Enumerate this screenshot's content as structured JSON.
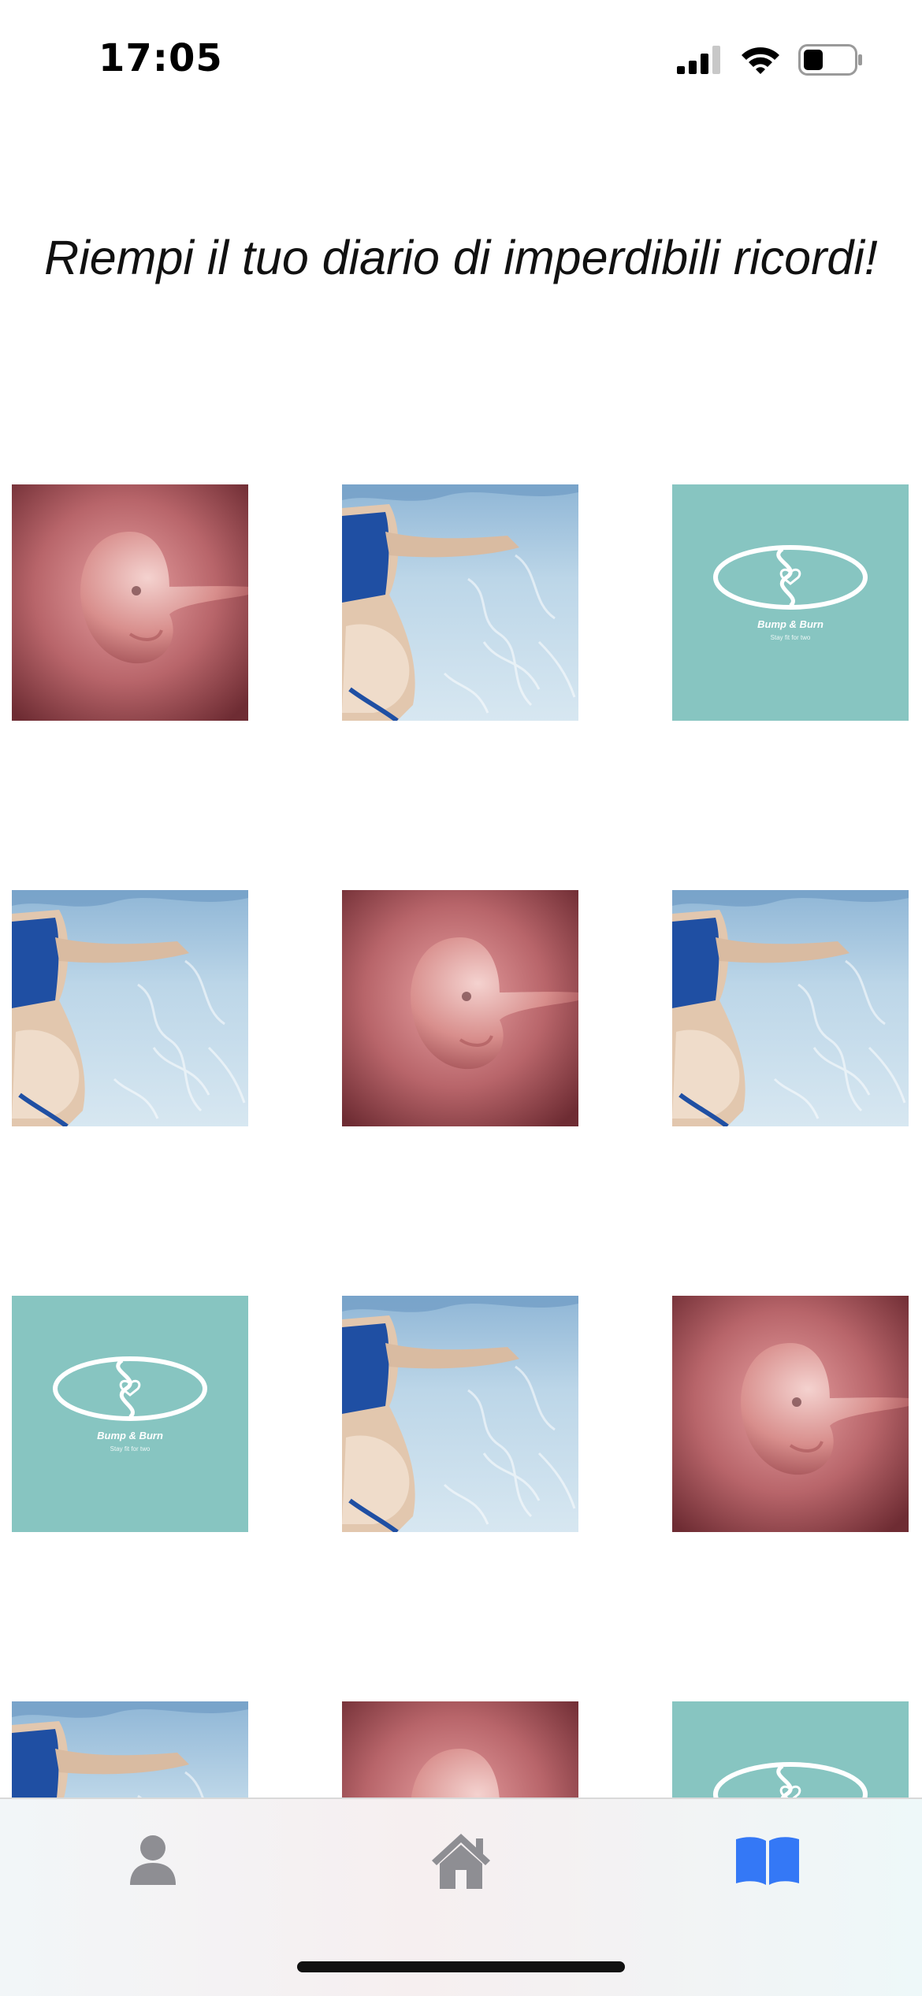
{
  "status_bar": {
    "time": "17:05",
    "icons": [
      "cellular-signal-icon",
      "wifi-icon",
      "battery-icon"
    ]
  },
  "header": {
    "title": "Riempi il tuo diario di imperdibili ricordi!"
  },
  "gallery": {
    "tiles": [
      {
        "kind": "embryo"
      },
      {
        "kind": "swimmer"
      },
      {
        "kind": "logo"
      },
      {
        "kind": "swimmer"
      },
      {
        "kind": "embryo"
      },
      {
        "kind": "swimmer"
      },
      {
        "kind": "logo"
      },
      {
        "kind": "swimmer"
      },
      {
        "kind": "embryo"
      },
      {
        "kind": "swimmer"
      },
      {
        "kind": "embryo"
      },
      {
        "kind": "logo"
      }
    ],
    "logo_text": {
      "brand": "Bump & Burn",
      "tagline": "Stay fit for two"
    }
  },
  "tab_bar": {
    "items": [
      {
        "name": "profile",
        "icon": "person-icon",
        "active": false
      },
      {
        "name": "home",
        "icon": "house-icon",
        "active": false
      },
      {
        "name": "diary",
        "icon": "book-icon",
        "active": true
      }
    ],
    "active_color": "#3478f6",
    "inactive_color": "#8e8e93"
  },
  "colors": {
    "logo_bg": "#87c5c1",
    "embryo_bg": "#a5565c"
  }
}
